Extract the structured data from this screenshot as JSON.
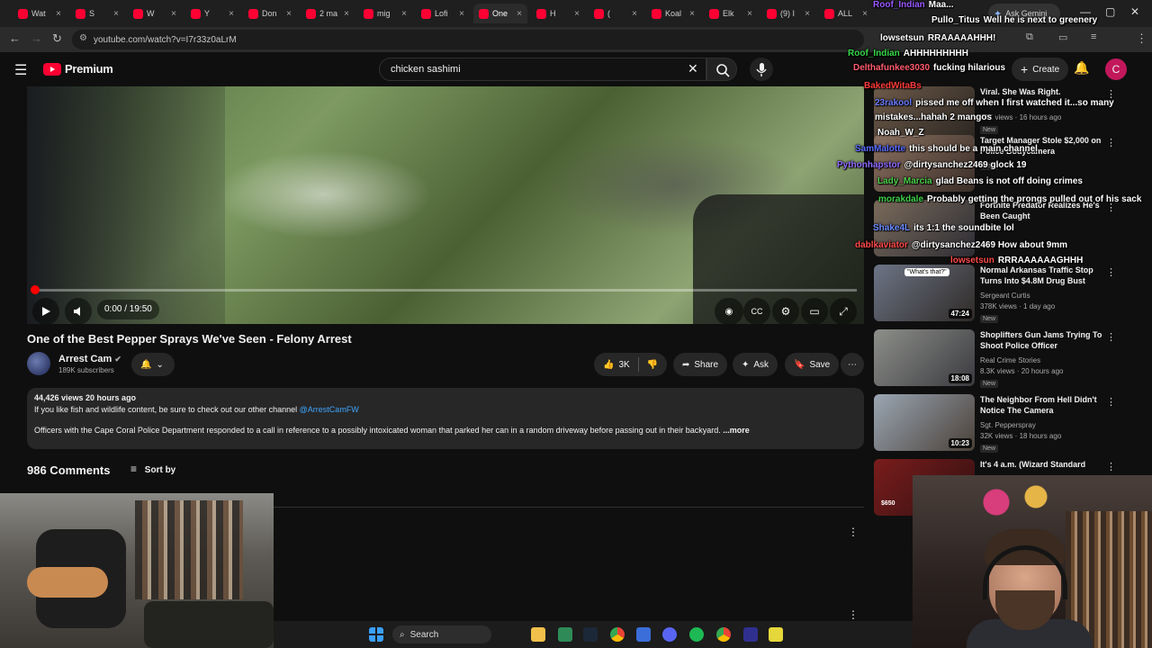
{
  "browser": {
    "tabs": [
      {
        "label": "Wat",
        "active": false
      },
      {
        "label": "S",
        "active": false
      },
      {
        "label": "W",
        "active": false
      },
      {
        "label": "Y",
        "active": false
      },
      {
        "label": "Don",
        "active": false
      },
      {
        "label": "2 ma",
        "active": false
      },
      {
        "label": "mig",
        "active": false
      },
      {
        "label": "Lofi",
        "active": false
      },
      {
        "label": "One",
        "active": true
      },
      {
        "label": "H",
        "active": false
      },
      {
        "label": "(",
        "active": false
      },
      {
        "label": "Koal",
        "active": false
      },
      {
        "label": "Elk",
        "active": false
      },
      {
        "label": "(9) I",
        "active": false
      },
      {
        "label": "ALL",
        "active": false
      }
    ],
    "ask_gemini": "Ask Gemini",
    "url": "youtube.com/watch?v=I7r33z0aLrM"
  },
  "youtube": {
    "logo_text": "Premium",
    "search_value": "chicken sashimi",
    "create_label": "Create",
    "avatar_letter": "C",
    "video": {
      "time": "0:00 / 19:50",
      "progress_fraction": 0.0
    },
    "title": "One of the Best Pepper Sprays We've Seen - Felony Arrest",
    "channel": {
      "name": "Arrest Cam",
      "subs": "189K subscribers"
    },
    "actions": {
      "likes": "3K",
      "share": "Share",
      "ask": "Ask",
      "save": "Save"
    },
    "description": {
      "meta": "44,426 views  20 hours ago",
      "line1_prefix": "If you like fish and wildlife content, be sure to check out our other channel ",
      "line1_link": "@ArrestCamFW",
      "line2": "Officers with the Cape Coral Police Department responded to a call in reference to a possibly intoxicated woman that parked her can in a random driveway before passing out in their backyard.",
      "more": "...more"
    },
    "comments": {
      "count": "986 Comments",
      "sort": "Sort by"
    },
    "recommendations": [
      {
        "title": "Viral. She Was Right.",
        "channel": "",
        "meta": "46K views · 16 hours ago",
        "duration": "",
        "badge": "New"
      },
      {
        "title": "Target Manager Stole $2,000 on Police Bodycamera",
        "channel": "",
        "meta": "",
        "duration": "",
        "badge": "New"
      },
      {
        "title": "Fortnite Predator Realizes He's Been Caught",
        "channel": "",
        "meta": "",
        "duration": "",
        "badge": ""
      },
      {
        "title": "Normal Arkansas Traffic Stop Turns Into $4.8M Drug Bust",
        "channel": "Sergeant Curtis",
        "meta": "378K views · 1 day ago",
        "duration": "47:24",
        "badge": "New"
      },
      {
        "title": "Shoplifters Gun Jams Trying To Shoot Police Officer",
        "channel": "Real Crime Stories",
        "meta": "8.3K views · 20 hours ago",
        "duration": "18:08",
        "badge": "New"
      },
      {
        "title": "The Neighbor From Hell Didn't Notice The Camera",
        "channel": "Sgt. Pepperspray",
        "meta": "32K views · 18 hours ago",
        "duration": "10:23",
        "badge": "New"
      },
      {
        "title": "It's 4 a.m. (Wizard Standard",
        "channel": "",
        "meta": "",
        "duration": "",
        "badge": ""
      }
    ],
    "thumb_labels": {
      "question": "\"What's that?\"",
      "price": "$650"
    }
  },
  "chat": [
    {
      "user": "Roof_Indian",
      "msg": "Maa...",
      "color": "#9b59ff"
    },
    {
      "user": "Pullo_Titus",
      "msg": "Well he is next to greenery",
      "color": "#ffffff"
    },
    {
      "user": "lowsetsun",
      "msg": "RRAAAAAHHH!",
      "color": "#ffffff"
    },
    {
      "user": "Roof_Indian",
      "msg": "AHHHHHHHHH",
      "color": "#36d84a"
    },
    {
      "user": "Delthafunkee3030",
      "msg": "fucking hilarious",
      "color": "#ff5b6e"
    },
    {
      "user": "BakedWitaBs",
      "msg": "",
      "color": "#ff3a3a"
    },
    {
      "user": "23rakool",
      "msg": "pissed me off when I first watched it...so many mistakes...hahah 2 mangos",
      "color": "#6a7bff"
    },
    {
      "user": "Noah_W_Z",
      "msg": "",
      "color": "#ffffff"
    },
    {
      "user": "SamMalotte",
      "msg": "this should be a main channel",
      "color": "#5a6cff"
    },
    {
      "user": "Pythonhapstor",
      "msg": "@dirtysanchez2469 glock 19",
      "color": "#8f6bff"
    },
    {
      "user": "Lady_Marcia",
      "msg": "glad Beans is not off doing crimes",
      "color": "#4cd04c"
    },
    {
      "user": "morakdale",
      "msg": "Probably getting the prongs pulled out of his sack",
      "color": "#3fd04a"
    },
    {
      "user": "Shake4L",
      "msg": "its 1:1 the soundbite lol",
      "color": "#6b8cff"
    },
    {
      "user": "dablkaviator",
      "msg": "@dirtysanchez2469 How about 9mm",
      "color": "#ff4a4a"
    },
    {
      "user": "lowsetsun",
      "msg": "RRRAAAAAAGHHH",
      "color": "#ff4a4a"
    }
  ],
  "taskbar": {
    "search_label": "Search"
  },
  "colors": {
    "yt_red": "#ff0033",
    "link_blue": "#3ea6ff",
    "bg": "#0f0f0f"
  }
}
